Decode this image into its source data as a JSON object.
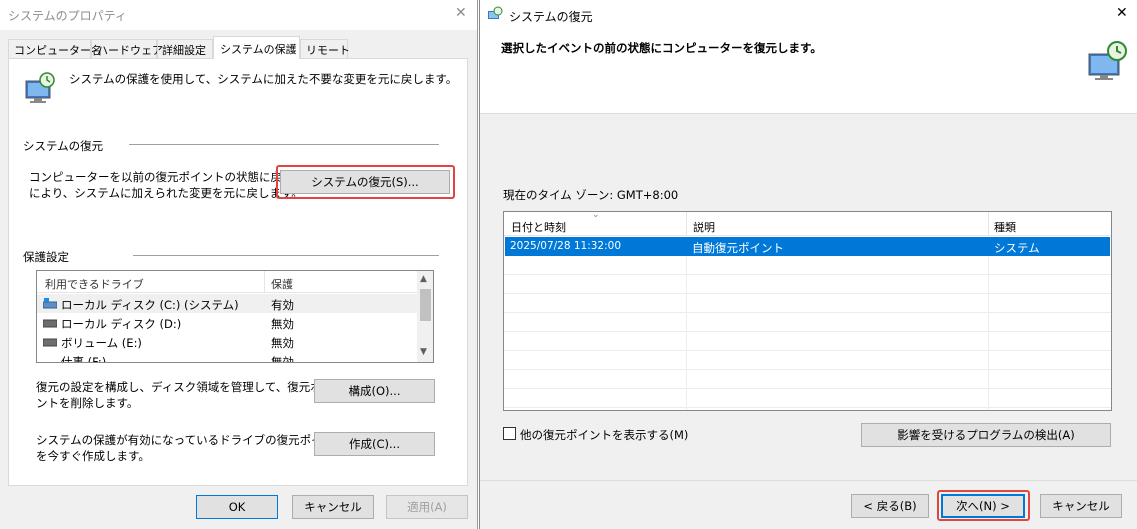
{
  "left": {
    "title": "システムのプロパティ",
    "close_glyph": "✕",
    "tabs": [
      "コンピューター名",
      "ハードウェア",
      "詳細設定",
      "システムの保護",
      "リモート"
    ],
    "intro": "システムの保護を使用して、システムに加えた不要な変更を元に戻します。",
    "restore_section": "システムの復元",
    "restore_desc1": "コンピューターを以前の復元ポイントの状態に戻すこと",
    "restore_desc2": "により、システムに加えられた変更を元に戻します。",
    "restore_button": "システムの復元(S)...",
    "protection_section": "保護設定",
    "drives_headers": [
      "利用できるドライブ",
      "保護"
    ],
    "drives": [
      {
        "name": "ローカル ディスク (C:) (システム)",
        "status": "有効"
      },
      {
        "name": "ローカル ディスク (D:)",
        "status": "無効"
      },
      {
        "name": "ボリューム (E:)",
        "status": "無効"
      },
      {
        "name": "仕事 (F:)",
        "status": "無効"
      }
    ],
    "configure_desc1": "復元の設定を構成し、ディスク領域を管理して、復元ポイ",
    "configure_desc2": "ントを削除します。",
    "configure_button": "構成(O)...",
    "create_desc1": "システムの保護が有効になっているドライブの復元ポイント",
    "create_desc2": "を今すぐ作成します。",
    "create_button": "作成(C)...",
    "ok": "OK",
    "cancel": "キャンセル",
    "apply": "適用(A)"
  },
  "right": {
    "title": "システムの復元",
    "close_glyph": "✕",
    "heading": "選択したイベントの前の状態にコンピューターを復元します。",
    "timezone": "現在のタイム ゾーン: GMT+8:00",
    "columns": [
      "日付と時刻",
      "説明",
      "種類"
    ],
    "rows": [
      {
        "date": "2025/07/28 11:32:00",
        "desc": "自動復元ポイント",
        "type": "システム"
      }
    ],
    "show_more": "他の復元ポイントを表示する(M)",
    "scan_button": "影響を受けるプログラムの検出(A)",
    "back": "< 戻る(B)",
    "next": "次へ(N) >",
    "cancel": "キャンセル"
  },
  "colors": {
    "highlight_border": "#e0463e",
    "selection": "#0078d7",
    "button_face": "#e1e1e1"
  }
}
